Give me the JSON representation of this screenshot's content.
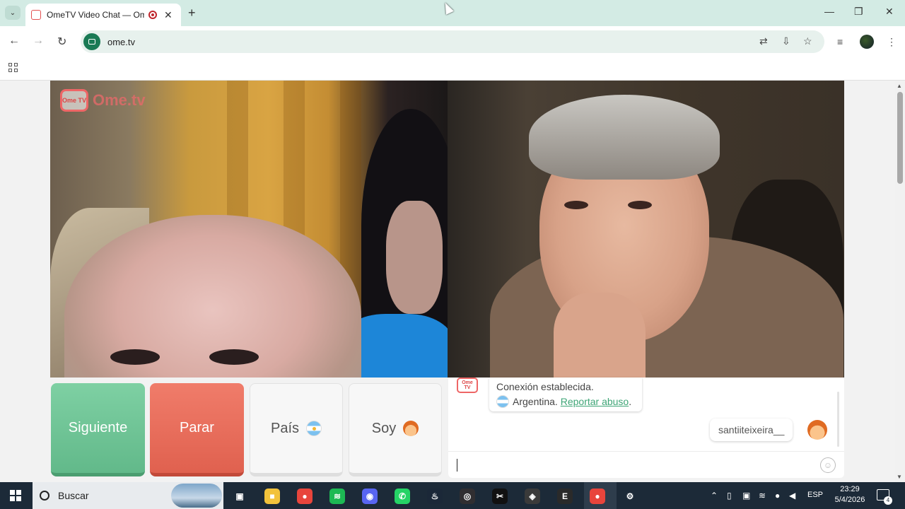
{
  "browser": {
    "tab_title": "OmeTV Video Chat — Ome",
    "url": "ome.tv",
    "tab_close": "✕",
    "new_tab": "+",
    "window_controls": {
      "minimize": "—",
      "restore": "❐",
      "close": "✕"
    },
    "nav": {
      "back": "←",
      "forward": "→",
      "reload": "↻"
    }
  },
  "page": {
    "logo_box": "Ome TV",
    "logo_text": "Ome.tv",
    "buttons": {
      "next": "Siguiente",
      "stop": "Parar",
      "country": "País",
      "gender": "Soy"
    },
    "chat": {
      "logo": "Ome TV",
      "system_line1": "Conexión establecida.",
      "system_country": "Argentina.",
      "system_report": "Reportar abuso",
      "user_message": "santiiteixeira__",
      "emoji_glyph": "☺"
    }
  },
  "taskbar": {
    "search_placeholder": "Buscar",
    "language": "ESP",
    "time": "23:29",
    "date": "5/4/2026",
    "notification_count": "4",
    "apps": [
      {
        "name": "task-view",
        "color": "#1c2a38",
        "glyph": "▣"
      },
      {
        "name": "file-explorer",
        "color": "#f2c23b",
        "glyph": "■"
      },
      {
        "name": "chrome",
        "color": "#e8453c",
        "glyph": "●"
      },
      {
        "name": "spotify",
        "color": "#1db954",
        "glyph": "≋"
      },
      {
        "name": "discord",
        "color": "#5865f2",
        "glyph": "◉"
      },
      {
        "name": "whatsapp",
        "color": "#25d366",
        "glyph": "✆"
      },
      {
        "name": "steam",
        "color": "#1b2838",
        "glyph": "♨"
      },
      {
        "name": "obs",
        "color": "#302e31",
        "glyph": "◎"
      },
      {
        "name": "capcut",
        "color": "#111",
        "glyph": "✂"
      },
      {
        "name": "davinci",
        "color": "#3a3a3a",
        "glyph": "◈"
      },
      {
        "name": "epic-games",
        "color": "#2a2a2a",
        "glyph": "E"
      },
      {
        "name": "chrome-active",
        "color": "#e8453c",
        "glyph": "●"
      },
      {
        "name": "settings",
        "color": "#1c2a38",
        "glyph": "⚙"
      }
    ]
  },
  "colors": {
    "tabbar": "#d3ebe4",
    "next_button": "#6fc796",
    "stop_button": "#e86d5b",
    "link": "#3ea576",
    "taskbar": "#1c2a38"
  }
}
